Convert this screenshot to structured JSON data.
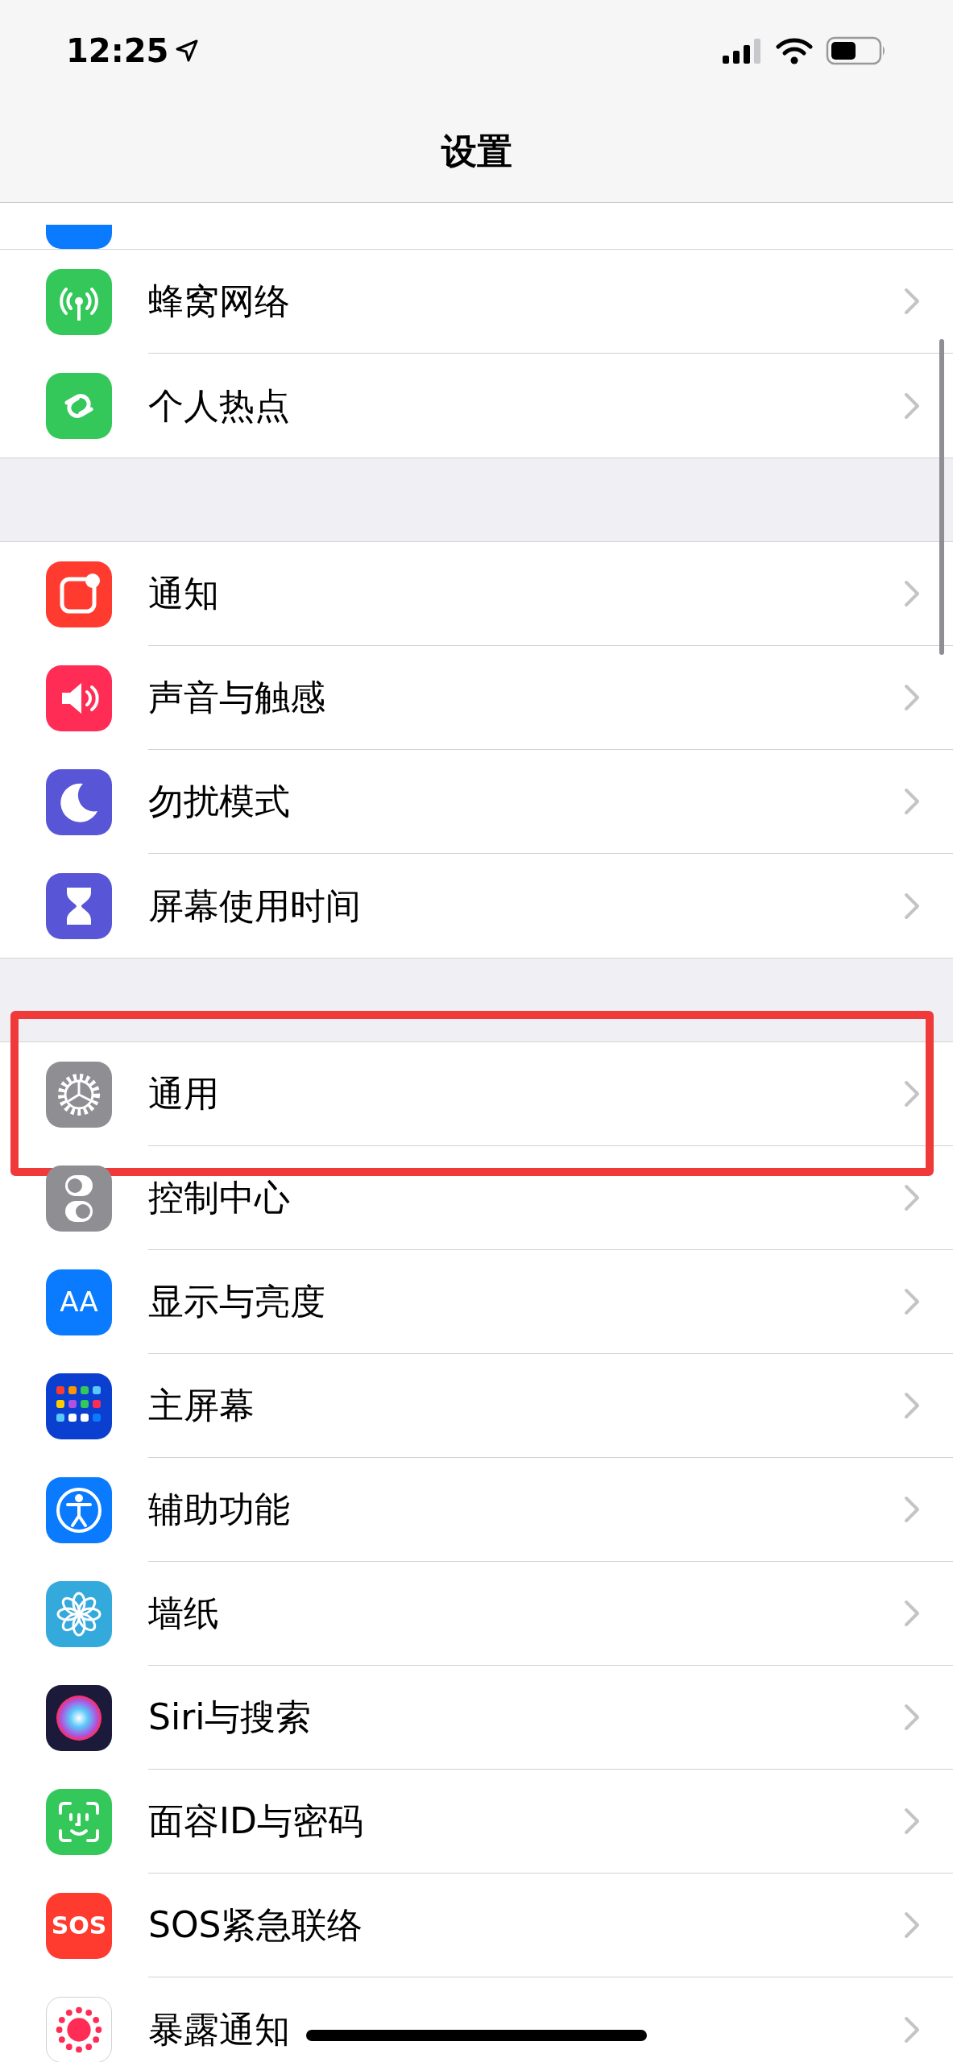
{
  "status_bar": {
    "time": "12:25"
  },
  "nav": {
    "title": "设置"
  },
  "groups": [
    {
      "items": [
        {
          "kind": "cellular",
          "label": "蜂窝网络",
          "highlighted": false
        },
        {
          "kind": "hotspot",
          "label": "个人热点",
          "highlighted": false
        }
      ]
    },
    {
      "items": [
        {
          "kind": "notifications",
          "label": "通知",
          "highlighted": false
        },
        {
          "kind": "sounds",
          "label": "声音与触感",
          "highlighted": false
        },
        {
          "kind": "moon",
          "label": "勿扰模式",
          "highlighted": false
        },
        {
          "kind": "hourglass",
          "label": "屏幕使用时间",
          "highlighted": false
        }
      ]
    },
    {
      "items": [
        {
          "kind": "gear",
          "label": "通用",
          "highlighted": true
        },
        {
          "kind": "toggles",
          "label": "控制中心",
          "highlighted": false
        },
        {
          "kind": "display",
          "icon_text": "AA",
          "label": "显示与亮度",
          "highlighted": false
        },
        {
          "kind": "homescreen",
          "label": "主屏幕",
          "highlighted": false
        },
        {
          "kind": "accessibility",
          "label": "辅助功能",
          "highlighted": false
        },
        {
          "kind": "flower",
          "label": "墙纸",
          "highlighted": false
        },
        {
          "kind": "siri",
          "label": "Siri与搜索",
          "highlighted": false
        },
        {
          "kind": "face",
          "label": "面容ID与密码",
          "highlighted": false
        },
        {
          "kind": "sos",
          "icon_text": "SOS",
          "label": "SOS紧急联络",
          "highlighted": false
        },
        {
          "kind": "exposure",
          "label": "暴露通知",
          "highlighted": false
        }
      ]
    }
  ]
}
